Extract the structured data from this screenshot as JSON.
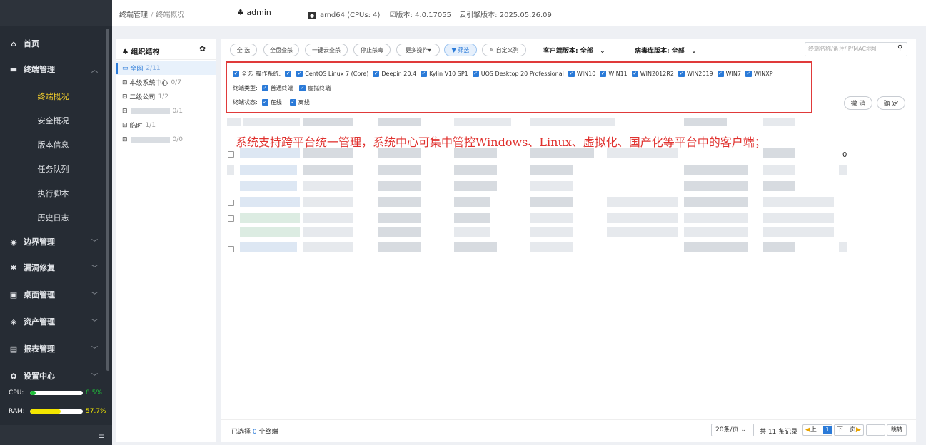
{
  "topbar": {
    "breadcrumb_parent": "终端管理",
    "breadcrumb_separator": "/",
    "breadcrumb_current": "终端概况",
    "user": "admin",
    "platform": "amd64 (CPUs: 4)",
    "version": "版本: 4.0.17055",
    "engine_version": "云引擎版本: 2025.05.26.09"
  },
  "sidebar": {
    "home": "首页",
    "terminal_mgmt": "终端管理",
    "sub_items": [
      "终端概况",
      "安全概况",
      "版本信息",
      "任务队列",
      "执行脚本",
      "历史日志"
    ],
    "sections": [
      "边界管理",
      "漏洞修复",
      "桌面管理",
      "资产管理",
      "报表管理",
      "设置中心"
    ],
    "cpu_label": "CPU:",
    "cpu_value": "8.5%",
    "cpu_fraction": 0.085,
    "ram_label": "RAM:",
    "ram_value": "57.7%",
    "ram_fraction": 0.577
  },
  "org": {
    "title": "组织结构",
    "items": [
      {
        "label": "全网",
        "count": "2/11"
      },
      {
        "label": "本级系统中心",
        "count": "0/7"
      },
      {
        "label": "二级公司",
        "count": "1/2"
      },
      {
        "label": "",
        "count": "0/1"
      },
      {
        "label": "临时",
        "count": "1/1"
      },
      {
        "label": "",
        "count": "0/0"
      }
    ]
  },
  "toolbar": {
    "select_all": "全 选",
    "full_scan": "全盘查杀",
    "cloud_scan": "一键云查杀",
    "stop_scan": "停止杀毒",
    "more_ops": "更多操作",
    "filter": "筛选",
    "custom_columns": "自定义列",
    "client_version_label": "客户端版本: 全部",
    "virus_db_version_label": "病毒库版本: 全部",
    "search_placeholder": "终端名称/备注/IP/MAC地址"
  },
  "filter_panel": {
    "all_label": "全选",
    "os_label": "操作系统:",
    "os_options": [
      "CentOS Linux 7 (Core)",
      "Deepin 20.4",
      "Kylin V10 SP1",
      "UOS Desktop 20 Professional",
      "WIN10",
      "WIN11",
      "WIN2012R2",
      "WIN2019",
      "WIN7",
      "WINXP"
    ],
    "type_label": "终端类型:",
    "type_options": [
      "普通终端",
      "虚拟终端"
    ],
    "status_label": "终端状态:",
    "status_options": [
      "在线",
      "离线"
    ],
    "cancel": "撤 消",
    "confirm": "确 定"
  },
  "overlay_text": "系统支持跨平台统一管理，系统中心可集中管控Windows、Linux、虚拟化、国产化等平台中的客户端；",
  "table": {
    "visible_value": "0"
  },
  "footer": {
    "selected_prefix": "已选择",
    "selected_count": "0",
    "selected_suffix": "个终端",
    "page_size": "20条/页",
    "total": "共 11 条记录",
    "prev": "上一页",
    "page": "1",
    "next": "下一页",
    "jump": "跳转"
  },
  "colors": {
    "accent": "#2a7ad8",
    "sidebar_bg": "#262c34",
    "active_menu": "#f4d02c",
    "highlight_border": "#e03a3a",
    "cpu_fill": "#1fbf3a",
    "ram_fill": "#f3e600"
  }
}
